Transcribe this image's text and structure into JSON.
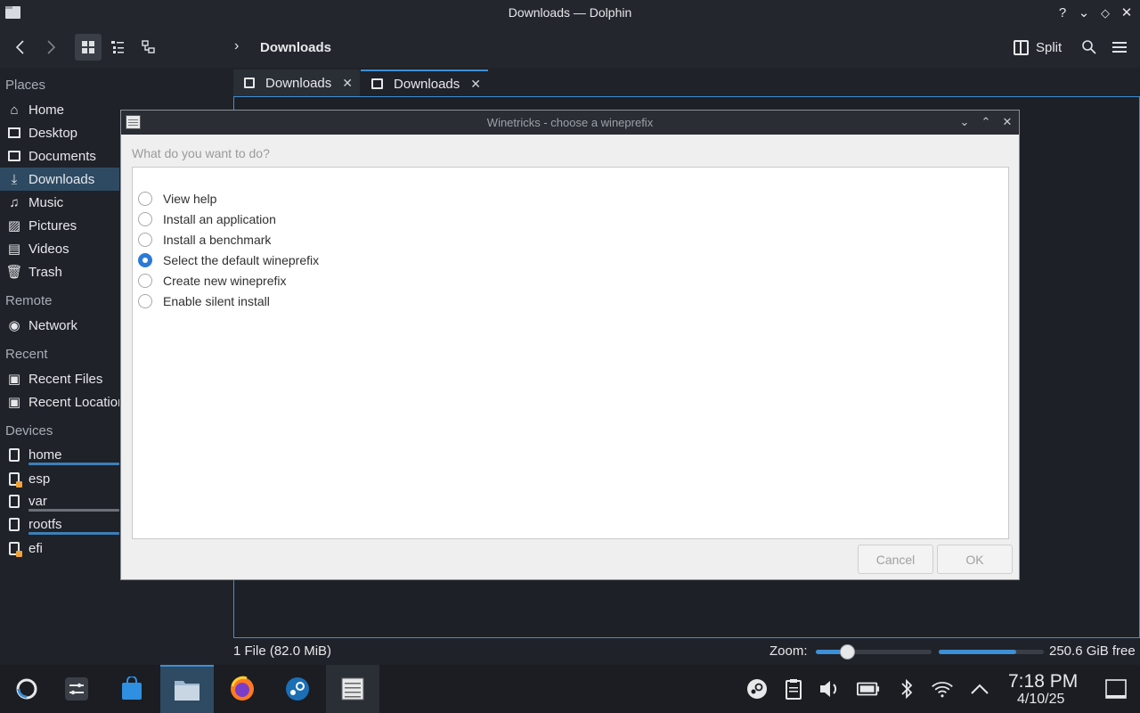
{
  "window": {
    "title": "Downloads — Dolphin"
  },
  "toolbar": {
    "breadcrumb": "Downloads",
    "split_label": "Split"
  },
  "sidebar": {
    "places_header": "Places",
    "places": [
      {
        "label": "Home",
        "icon": "home-icon"
      },
      {
        "label": "Desktop",
        "icon": "desktop-icon"
      },
      {
        "label": "Documents",
        "icon": "documents-icon"
      },
      {
        "label": "Downloads",
        "icon": "downloads-icon",
        "selected": true
      },
      {
        "label": "Music",
        "icon": "music-icon"
      },
      {
        "label": "Pictures",
        "icon": "pictures-icon"
      },
      {
        "label": "Videos",
        "icon": "videos-icon"
      },
      {
        "label": "Trash",
        "icon": "trash-icon"
      }
    ],
    "remote_header": "Remote",
    "remote": [
      {
        "label": "Network",
        "icon": "network-icon"
      }
    ],
    "recent_header": "Recent",
    "recent": [
      {
        "label": "Recent Files",
        "icon": "recent-files-icon"
      },
      {
        "label": "Recent Locations",
        "icon": "recent-locations-icon"
      }
    ],
    "devices_header": "Devices",
    "devices": [
      {
        "label": "home",
        "icon": "drive-icon"
      },
      {
        "label": "esp",
        "icon": "drive-warning-icon"
      },
      {
        "label": "var",
        "icon": "drive-icon"
      },
      {
        "label": "rootfs",
        "icon": "drive-icon"
      },
      {
        "label": "efi",
        "icon": "drive-warning-icon"
      }
    ]
  },
  "tabs": [
    {
      "label": "Downloads",
      "active": false
    },
    {
      "label": "Downloads",
      "active": true
    }
  ],
  "statusbar": {
    "file_info": "1 File (82.0 MiB)",
    "zoom_label": "Zoom:",
    "zoom_fraction": 0.28,
    "space_used_fraction": 0.74,
    "free_space": "250.6 GiB free"
  },
  "dialog": {
    "title": "Winetricks - choose a wineprefix",
    "question": "What do you want to do?",
    "options": [
      {
        "label": "View help",
        "selected": false
      },
      {
        "label": "Install an application",
        "selected": false
      },
      {
        "label": "Install a benchmark",
        "selected": false
      },
      {
        "label": "Select the default wineprefix",
        "selected": true
      },
      {
        "label": "Create new wineprefix",
        "selected": false
      },
      {
        "label": "Enable silent install",
        "selected": false
      }
    ],
    "cancel_label": "Cancel",
    "ok_label": "OK"
  },
  "taskbar": {
    "clock_time": "7:18 PM",
    "clock_date": "4/10/25"
  },
  "colors": {
    "accent": "#3d8fd6",
    "selection": "#2e4a63",
    "radio_selected": "#2c7ad6",
    "drive_warning": "#f0a33a"
  }
}
